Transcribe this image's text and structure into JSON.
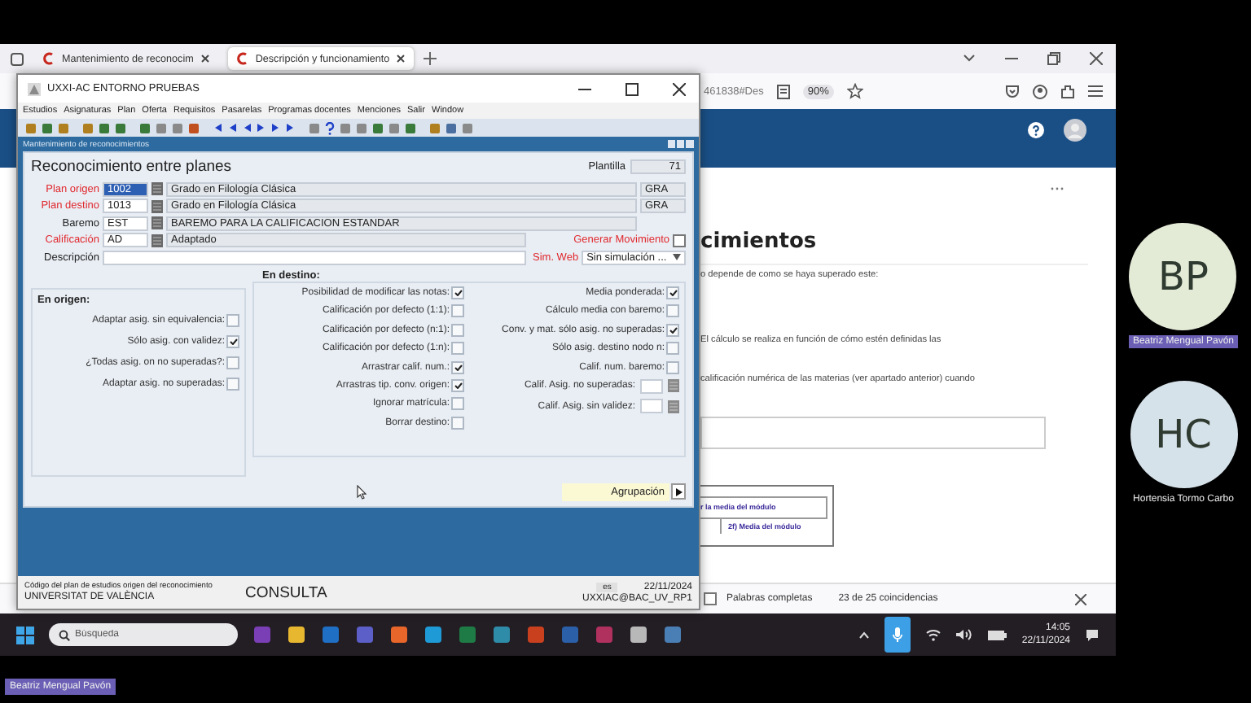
{
  "browser": {
    "tabs": [
      {
        "title": "Mantenimiento de reconocim",
        "selected": false
      },
      {
        "title": "Descripción y funcionamiento",
        "selected": true
      }
    ],
    "address_fragment": "461838#Des",
    "zoom": "90%",
    "page": {
      "heading": "cimientos",
      "paragraphs": [
        "o depende de como se haya superado este:",
        "El cálculo se realiza en función de cómo estén definidas las",
        "calificación numérica de las materias (ver apartado anterior) cuando"
      ],
      "table_cells": [
        "r la media del módulo",
        "2f) Media del módulo"
      ]
    },
    "find_bar": {
      "whole_words_label": "Palabras completas",
      "whole_words_checked": false,
      "matches": "23 de 25 coincidencias"
    }
  },
  "app_window": {
    "title": "UXXI-AC ENTORNO PRUEBAS",
    "menu": [
      "Estudios",
      "Asignaturas",
      "Plan",
      "Oferta",
      "Requisitos",
      "Pasarelas",
      "Programas docentes",
      "Menciones",
      "Salir",
      "Window"
    ],
    "inner_title": "Mantenimiento de reconocimientos",
    "form": {
      "title": "Reconocimiento entre planes",
      "template_label": "Plantilla",
      "template_value": "71",
      "rows": [
        {
          "label": "Plan origen",
          "required": true,
          "code": "1002",
          "code_selected": true,
          "description": "Grado en Filología Clásica",
          "type": "GRA"
        },
        {
          "label": "Plan destino",
          "required": true,
          "code": "1013",
          "code_selected": false,
          "description": "Grado en Filología Clásica",
          "type": "GRA"
        },
        {
          "label": "Baremo",
          "required": false,
          "code": "EST",
          "code_selected": false,
          "description": "BAREMO PARA LA CALIFICACION ESTANDAR",
          "type": ""
        },
        {
          "label": "Calificación",
          "required": true,
          "code": "AD",
          "code_selected": false,
          "description": "Adaptado"
        }
      ],
      "generate_movement": {
        "label": "Generar Movimiento",
        "checked": false
      },
      "description_label": "Descripción",
      "sim_web": {
        "label": "Sim. Web",
        "value": "Sin simulación ..."
      },
      "origin": {
        "title": "En origen:",
        "options": [
          {
            "label": "Adaptar asig. sin equivalencia:",
            "checked": false
          },
          {
            "label": "Sólo asig. con validez:",
            "checked": true
          },
          {
            "label": "¿Todas asig. on no superadas?:",
            "checked": false
          },
          {
            "label": "Adaptar asig. no superadas:",
            "checked": false
          }
        ]
      },
      "destination": {
        "title": "En destino:",
        "left_options": [
          {
            "label": "Posibilidad de modificar las notas:",
            "checked": true
          },
          {
            "label": "Calificación por defecto (1:1):",
            "checked": false
          },
          {
            "label": "Calificación por defecto (n:1):",
            "checked": false
          },
          {
            "label": "Calificación por defecto (1:n):",
            "checked": false
          },
          {
            "label": "Arrastrar calif. num.:",
            "checked": true
          },
          {
            "label": "Arrastras tip. conv. origen:",
            "checked": true
          },
          {
            "label": "Ignorar matrícula:",
            "checked": false
          },
          {
            "label": "Borrar destino:",
            "checked": false
          }
        ],
        "right_options": [
          {
            "label": "Media ponderada:",
            "checked": true
          },
          {
            "label": "Cálculo media con baremo:",
            "checked": false
          },
          {
            "label": "Conv. y mat. sólo asig. no superadas:",
            "checked": true
          },
          {
            "label": "Sólo asig. destino nodo n:",
            "checked": false
          },
          {
            "label": "Calif. num. baremo:",
            "checked": false
          }
        ],
        "fields": [
          "Calif. Asig. no superadas:",
          "Calif. Asig. sin validez:"
        ]
      },
      "group_button": "Agrupación"
    },
    "status_bar": {
      "hint": "Código del plan de estudios origen del reconocimiento",
      "organization": "UNIVERSITAT DE VALÈNCIA",
      "mode": "CONSULTA",
      "language": "es",
      "date": "22/11/2024",
      "user": "UXXIAC@BAC_UV_RP1"
    }
  },
  "taskbar": {
    "search_placeholder": "Búsqueda",
    "time": "14:05",
    "date": "22/11/2024"
  },
  "participants": [
    {
      "initials": "BP",
      "name": "Beatriz Mengual Pavón",
      "color": "#e3ead6",
      "highlighted": true
    },
    {
      "initials": "HC",
      "name": "Hortensia Tormo Carbo",
      "color": "#d6e2ea",
      "highlighted": false
    }
  ],
  "presenter_label": "Beatriz Mengual Pavón"
}
